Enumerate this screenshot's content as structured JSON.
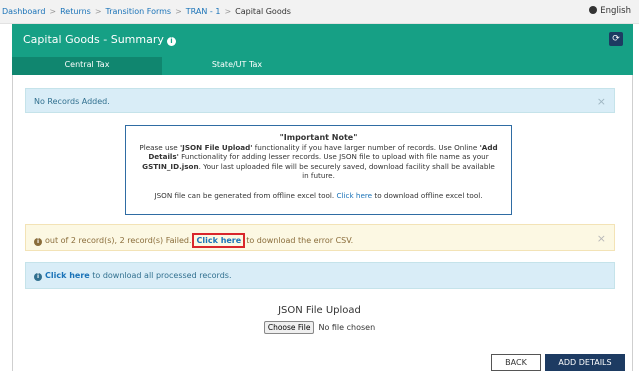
{
  "breadcrumb": {
    "items": [
      "Dashboard",
      "Returns",
      "Transition Forms",
      "TRAN - 1"
    ],
    "current": "Capital Goods",
    "separator": ">"
  },
  "language": "English",
  "header": {
    "title": "Capital Goods - Summary",
    "info_glyph": "i",
    "refresh_glyph": "⟳",
    "tabs": [
      "Central Tax",
      "State/UT Tax"
    ]
  },
  "alerts": {
    "no_records": "No Records Added.",
    "close_glyph": "×",
    "failed": {
      "text_before": "out of 2 record(s), 2 record(s) Failed.",
      "link": "Click here",
      "text_after": "to download the error CSV."
    },
    "processed": {
      "link": "Click here",
      "text_after": "to download all processed records."
    }
  },
  "note": {
    "title": "\"Important Note\"",
    "line1_a": "Please use ",
    "line1_b": "'JSON File Upload'",
    "line1_c": " functionality if you have larger number of records. Use Online ",
    "line1_d": "'Add Details'",
    "line1_e": " Functionality for adding lesser records. Use JSON file to upload with file name as your ",
    "line1_f": "GSTIN_ID.json",
    "line1_g": ". Your last uploaded file will be securely saved, download facility shall be available in future.",
    "line2_a": "JSON file can be generated from offline excel tool. ",
    "line2_link": "Click here",
    "line2_b": " to download offline excel tool."
  },
  "upload": {
    "label": "JSON File Upload",
    "button": "Choose File",
    "status": "No file chosen"
  },
  "buttons": {
    "back": "BACK",
    "add_details": "ADD DETAILS"
  },
  "colors": {
    "header_teal": "#16a085",
    "navy": "#1d3b62",
    "link_blue": "#1a73b8",
    "highlight_red": "#d9262c"
  }
}
